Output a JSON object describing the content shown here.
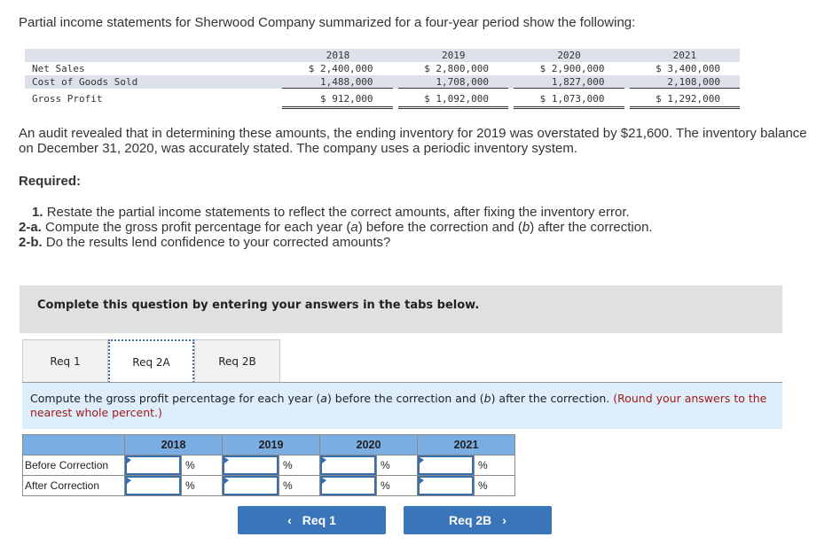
{
  "intro": "Partial income statements for Sherwood Company summarized for a four-year period show the following:",
  "statement": {
    "years": [
      "2018",
      "2019",
      "2020",
      "2021"
    ],
    "rows": [
      {
        "label": "Net Sales",
        "values": [
          "$ 2,400,000",
          "$ 2,800,000",
          "$ 2,900,000",
          "$ 3,400,000"
        ]
      },
      {
        "label": "Cost of Goods Sold",
        "values": [
          "1,488,000",
          "1,708,000",
          "1,827,000",
          "2,108,000"
        ]
      },
      {
        "label": "Gross Profit",
        "values": [
          "$ 912,000",
          "$ 1,092,000",
          "$ 1,073,000",
          "$ 1,292,000"
        ]
      }
    ]
  },
  "audit_paragraph": "An audit revealed that in determining these amounts, the ending inventory for 2019 was overstated by $21,600. The inventory balance on December 31, 2020, was accurately stated. The company uses a periodic inventory system.",
  "required": {
    "heading": "Required:",
    "items": [
      {
        "num": "1.",
        "text": "Restate the partial income statements to reflect the correct amounts, after fixing the inventory error."
      },
      {
        "num": "2-a.",
        "text_before": "Compute the gross profit percentage for each year (",
        "a": "a",
        "text_mid": ") before the correction and (",
        "b": "b",
        "text_after": ") after the correction."
      },
      {
        "num": "2-b.",
        "text": "Do the results lend confidence to your corrected amounts?"
      }
    ]
  },
  "banner": "Complete this question by entering your answers in the tabs below.",
  "tabs": [
    {
      "label": "Req 1",
      "active": false
    },
    {
      "label": "Req 2A",
      "active": true
    },
    {
      "label": "Req 2B",
      "active": false
    }
  ],
  "instruction": {
    "text_before": "Compute the gross profit percentage for each year (",
    "a": "a",
    "text_mid": ") before the correction and (",
    "b": "b",
    "text_after": ") after the correction. ",
    "note": "(Round your answers to the nearest whole percent.)"
  },
  "answer_grid": {
    "years": [
      "2018",
      "2019",
      "2020",
      "2021"
    ],
    "rows": [
      {
        "label": "Before Correction",
        "values": [
          "",
          "",
          "",
          ""
        ],
        "unit": "%"
      },
      {
        "label": "After Correction",
        "values": [
          "",
          "",
          "",
          ""
        ],
        "unit": "%"
      }
    ]
  },
  "nav": {
    "prev_label": "Req 1",
    "next_label": "Req 2B",
    "prev_icon": "‹",
    "next_icon": "›"
  },
  "colors": {
    "button": "#3a75ba",
    "grid_header": "#7aaee3",
    "instruction_bg": "#ddeefa",
    "note": "#a11a1a"
  }
}
